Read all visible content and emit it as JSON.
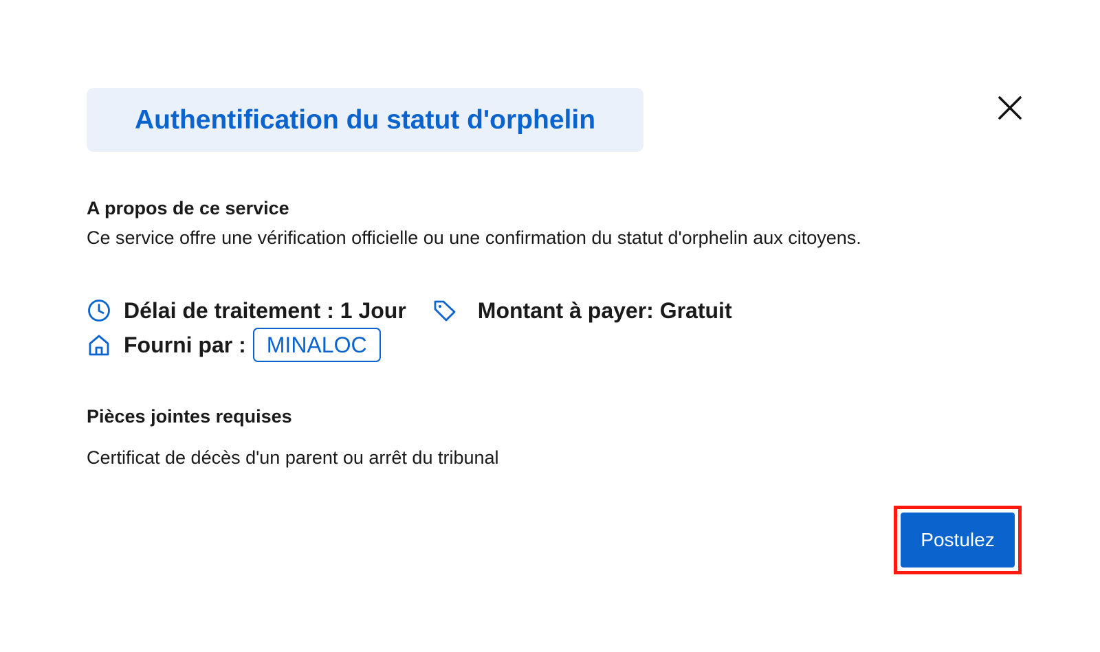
{
  "modal": {
    "title": "Authentification du statut d'orphelin",
    "close_icon": "close-icon"
  },
  "about": {
    "heading": "A propos de ce service",
    "description": "Ce service offre une vérification officielle ou une confirmation du statut d'orphelin aux citoyens."
  },
  "info": {
    "processing_icon": "clock-icon",
    "processing": "Délai de traitement : 1 Jour",
    "price_icon": "tag-icon",
    "price": "Montant à payer: Gratuit",
    "provider_icon": "home-icon",
    "provider_label": "Fourni par :",
    "provider_value": "MINALOC"
  },
  "attachments": {
    "heading": "Pièces jointes requises",
    "text": "Certificat de décès d'un parent ou arrêt du tribunal"
  },
  "actions": {
    "apply_label": "Postulez"
  },
  "colors": {
    "primary": "#0b63ce",
    "title_background": "#eaf1fb",
    "highlight_border": "#ff1a0f",
    "text": "#1a1a1a"
  }
}
